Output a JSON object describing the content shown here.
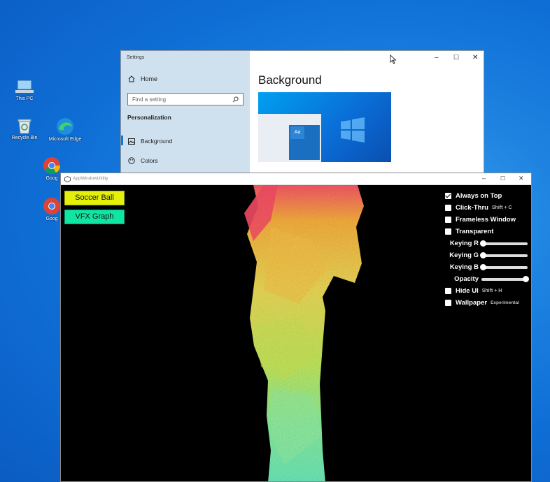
{
  "desktop": {
    "icons": [
      {
        "label": "This PC",
        "icon": "computer-icon"
      },
      {
        "label": "Recycle Bin",
        "icon": "recycle-bin-icon"
      },
      {
        "label": "Microsoft Edge",
        "icon": "edge-icon"
      },
      {
        "label": "Goog",
        "icon": "chrome-icon"
      },
      {
        "label": "Goog",
        "icon": "chrome-icon"
      }
    ]
  },
  "settings": {
    "title": "Settings",
    "home_label": "Home",
    "search_placeholder": "Find a setting",
    "section_label": "Personalization",
    "nav_items": [
      "Background",
      "Colors"
    ],
    "heading": "Background",
    "preview_sample": "Aa",
    "controls": {
      "minimize": "–",
      "maximize": "☐",
      "close": "✕"
    }
  },
  "app": {
    "title": "AppWindowUtility",
    "controls": {
      "minimize": "–",
      "maximize": "☐",
      "close": "✕"
    },
    "buttons": {
      "soccer_ball": "Soccer Ball",
      "vfx_graph": "VFX Graph"
    },
    "colors": {
      "soccer_ball": "#e5f00a",
      "vfx_graph": "#0fe6a2"
    },
    "options": {
      "always_on_top": {
        "label": "Always on Top",
        "checked": true
      },
      "click_thru": {
        "label": "Click-Thru",
        "hint": "Shift + C",
        "checked": false
      },
      "frameless_window": {
        "label": "Frameless Window",
        "checked": false
      },
      "transparent": {
        "label": "Transparent",
        "checked": false
      },
      "hide_ui": {
        "label": "Hide UI",
        "hint": "Shift + H",
        "checked": false
      },
      "wallpaper": {
        "label": "Wallpaper",
        "hint": "Experimental",
        "checked": false
      }
    },
    "sliders": {
      "keying_r": {
        "label": "Keying R",
        "value": 0.0
      },
      "keying_g": {
        "label": "Keying G",
        "value": 0.0
      },
      "keying_b": {
        "label": "Keying B",
        "value": 0.0
      },
      "opacity": {
        "label": "Opacity",
        "value": 1.0
      }
    }
  }
}
